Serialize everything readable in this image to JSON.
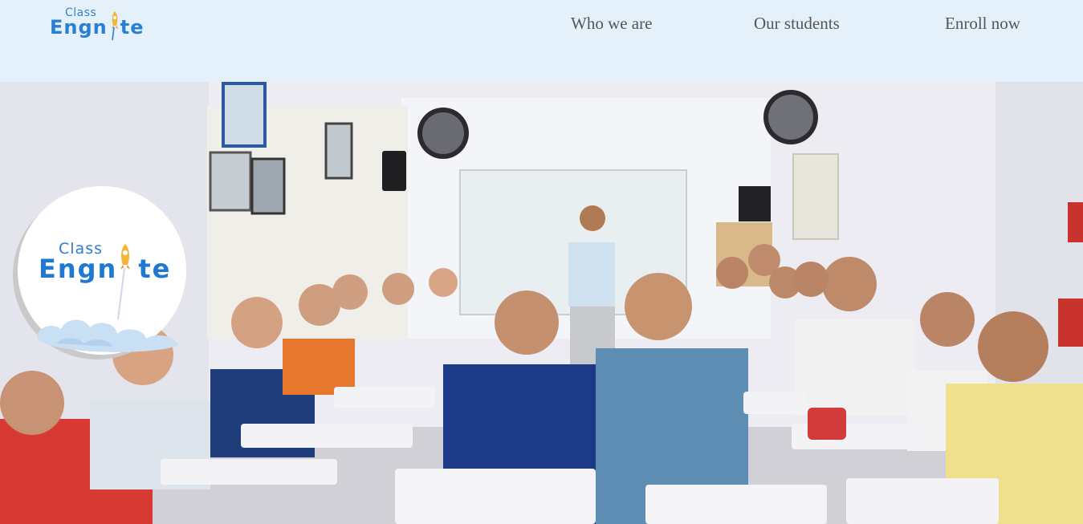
{
  "header": {
    "logo": {
      "word_top": "Class",
      "word_main": "Engn",
      "word_end": "te"
    },
    "nav": [
      {
        "label": "Who we are"
      },
      {
        "label": "Our students"
      },
      {
        "label": "Enroll now"
      }
    ]
  },
  "hero": {
    "image_description_icon": "classroom-photo",
    "badge": {
      "word_top": "Class",
      "word_main": "Engn",
      "word_end": "te"
    }
  },
  "colors": {
    "header_bg": "#e4f1fb",
    "brand_blue": "#2a7fd0",
    "nav_text": "#555555"
  }
}
